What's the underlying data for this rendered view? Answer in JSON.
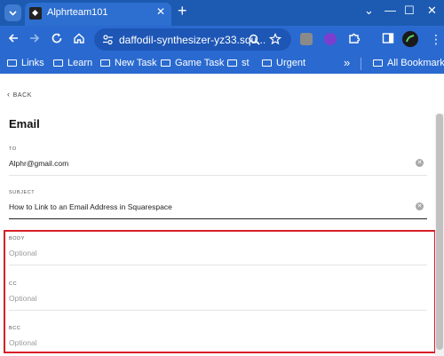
{
  "browser": {
    "tab_title": "Alphrteam101",
    "tab_close": "✕",
    "new_tab": "+",
    "url": "daffodil-synthesizer-yz33.squ...",
    "window_controls": {
      "collapse": "⌄",
      "minimize": "—",
      "maximize": "☐",
      "close": "✕"
    }
  },
  "bookmarks": {
    "items": [
      "Links",
      "Learn",
      "New Task",
      "Game Task",
      "st",
      "Urgent"
    ],
    "overflow": "»",
    "all": "All Bookmarks"
  },
  "page": {
    "back_label": "BACK",
    "title": "Email",
    "fields": {
      "to": {
        "label": "TO",
        "value": "Alphr@gmail.com"
      },
      "subject": {
        "label": "SUBJECT",
        "value": "How to Link to an Email Address in Squarespace"
      },
      "body": {
        "label": "BODY",
        "placeholder": "Optional"
      },
      "cc": {
        "label": "CC",
        "placeholder": "Optional"
      },
      "bcc": {
        "label": "BCC",
        "placeholder": "Optional"
      }
    }
  },
  "colors": {
    "chrome": "#2a6ad0",
    "highlight": "#d81f27"
  }
}
